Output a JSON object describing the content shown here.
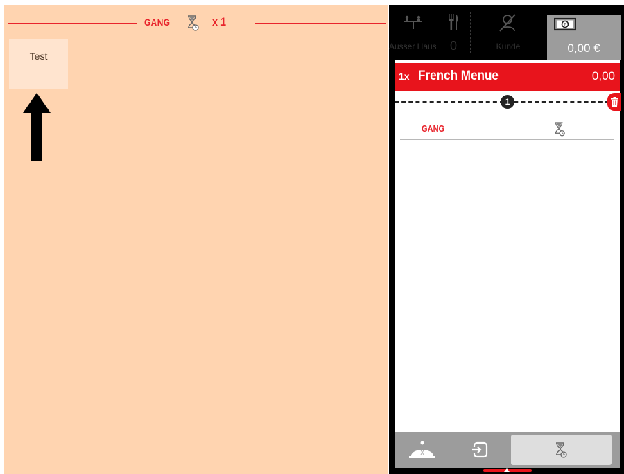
{
  "course_header": {
    "course_label": "GANG",
    "count_label": "x 1",
    "accent_color": "#e8242c"
  },
  "tiles": [
    {
      "label": "Test"
    }
  ],
  "pos": {
    "topbar": {
      "takeaway_label": "Ausser Haus",
      "guests_count": "0",
      "customer_label": "Kunde",
      "amount": "0,00 €"
    },
    "order": {
      "item": {
        "qty": "1x",
        "name": "French Menue",
        "price": "0,00"
      },
      "course_number": "1",
      "course_label": "GANG"
    }
  },
  "icons": {
    "takeaway": "takeaway-icon",
    "cutlery": "cutlery-icon",
    "customer": "customer-off-icon",
    "cash": "banknote-icon",
    "trash": "trash-icon",
    "hourglass": "hourglass-clock-icon",
    "cloche": "cloche-icon",
    "exit": "exit-icon"
  }
}
